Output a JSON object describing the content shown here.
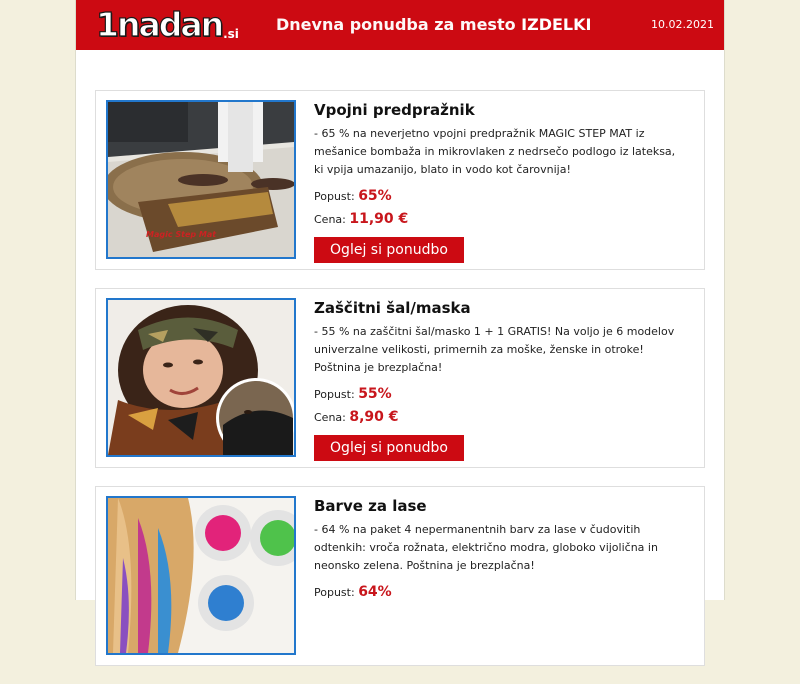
{
  "header": {
    "logo_text": "1nadan",
    "logo_suffix": ".si",
    "title_prefix": "Dnevna ponudba za mesto",
    "title_city": "IZDELKI",
    "date": "10.02.2021"
  },
  "products": [
    {
      "title": "Vpojni predpražnik",
      "description": "- 65 % na neverjetno vpojni predpražnik MAGIC STEP MAT iz mešanice bombaža in mikrovlaken z nedrsečo podlogo iz lateksa, ki vpija umazanijo, blato in vodo kot čarovnija!",
      "discount_label": "Popust:",
      "discount_value": "65%",
      "price_label": "Cena:",
      "price_value": "11,90 €",
      "button_label": "Oglej si ponudbo",
      "image_caption": "Magic Step Mat"
    },
    {
      "title": "Zaščitni šal/maska",
      "description": "- 55 % na zaščitni šal/masko 1 + 1 GRATIS! Na voljo je 6 modelov univerzalne velikosti, primernih za moške, ženske in otroke! Poštnina je brezplačna!",
      "discount_label": "Popust:",
      "discount_value": "55%",
      "price_label": "Cena:",
      "price_value": "8,90 €",
      "button_label": "Oglej si ponudbo"
    },
    {
      "title": "Barve za lase",
      "description": "- 64 % na paket 4 nepermanentnih barv za lase v čudovitih odtenkih: vroča rožnata, električno modra, globoko vijolična in neonsko zelena. Poštnina je brezplačna!",
      "discount_label": "Popust:",
      "discount_value": "64%"
    }
  ]
}
